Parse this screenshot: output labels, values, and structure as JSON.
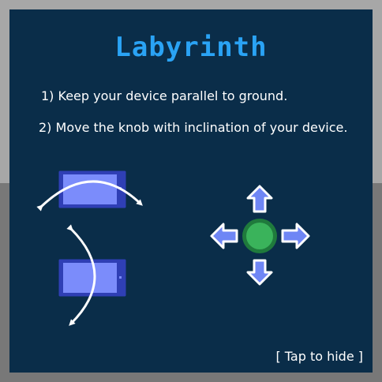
{
  "title": "Labyrinth",
  "instructions": [
    "1) Keep your device parallel to ground.",
    "2) Move the knob with inclination of your device."
  ],
  "tap_to_hide": "[ Tap to hide ]",
  "colors": {
    "panel": "#0a2d49",
    "title": "#2aa3f5",
    "device_body": "#2f3fb5",
    "device_screen": "#7b8cfb",
    "knob": "#3ab35b",
    "knob_ring": "#1f7a3c",
    "arrow": "#6f86f5",
    "outline": "#ffffff"
  },
  "icons": [
    "tilt-left-right-icon",
    "tilt-up-down-icon",
    "joystick-knob-icon",
    "arrow-up-icon",
    "arrow-down-icon",
    "arrow-left-icon",
    "arrow-right-icon"
  ]
}
